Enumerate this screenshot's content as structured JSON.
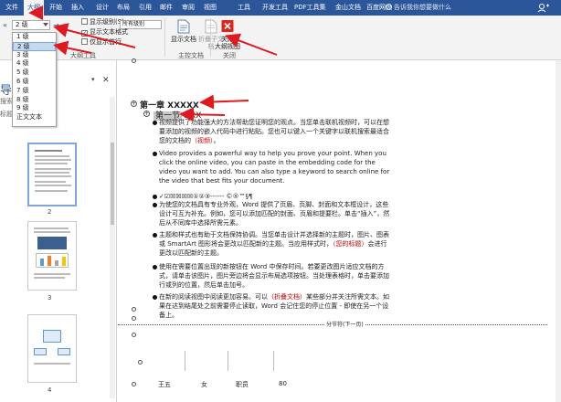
{
  "ribbon_tabs": [
    "文件",
    "大纲",
    "开始",
    "插入",
    "设计",
    "布局",
    "引用",
    "邮件",
    "审阅",
    "视图",
    "工具",
    "开发工具",
    "PDF工具集",
    "金山文档",
    "百度网盘"
  ],
  "active_tab": "大纲",
  "tell_me": "告诉我你想要做什么",
  "outline_tools": {
    "level_value": "2 级",
    "show_level_label": "显示级别(S):",
    "show_level_value": "所有级别",
    "show_text_format": "显示文本格式",
    "show_first_line": "仅显示首行",
    "group_label": "大纲工具"
  },
  "master_doc": {
    "show_document": "显示文档",
    "collapse_subdocs": "折叠子文档",
    "group_label": "主控文档"
  },
  "close_group": {
    "close_label_line1": "关闭",
    "close_label_line2": "大纲视图",
    "group_label": "关闭"
  },
  "level_dropdown": {
    "options": [
      "1 级",
      "2 级",
      "3 级",
      "4 级",
      "5 级",
      "6 级",
      "7 级",
      "8 级",
      "9 级",
      "正文文本"
    ],
    "selected_index": 1
  },
  "nav_pane": {
    "title": "导航",
    "search_placeholder": "搜索文档",
    "tabs_text": "标题",
    "page_numbers": [
      "2",
      "3",
      "4"
    ]
  },
  "document": {
    "heading1": "第一章  XXXXX",
    "heading2_highlight": "第一节",
    "heading2_rest": "XXX",
    "paras": [
      {
        "pre": "视频提供了功能强大的方法帮助您证明您的观点。当您单击联机视频时，可以在想要添加的视频的嵌入代码中进行粘贴。您也可以键入一个关键字以联机搜索最适合您的文档的",
        "red": "（视频）",
        "post": "。"
      },
      {
        "pre": "Video provides a powerful way to help you prove your point. When you click the online video, you can paste in the embedding code for the video you want to add. You can also type a keyword to search online for the video that best fits your document.",
        "red": "",
        "post": ""
      },
      {
        "pre": "✓☑☒☒☒☒①②③------      ©®™§¶",
        "red": "",
        "post": ""
      },
      {
        "pre": "为使您的文档具有专业外观，Word 提供了页眉、页脚、封面和文本框设计，这些设计可互为补充。例如，您可以添加匹配的封面、页眉和提要栏。单击“插入”，然后从不同库中选择所需元素。",
        "red": "",
        "post": ""
      },
      {
        "pre": "主题和样式也有助于文档保持协调。当您单击设计并选择新的主题时，图片、图表或 SmartArt 图形将会更改以匹配新的主题。当应用样式时，",
        "red": "（您的标题）",
        "post": "会进行更改以匹配新的主题。"
      },
      {
        "pre": "使用在需要位置出现的新按钮在 Word 中保存时间。若要更改图片适应文档的方式，请单击该图片，图片旁边将会显示布局选项按钮。当处理表格时，单击要添加行或列的位置，然后单击加号。",
        "red": "",
        "post": ""
      },
      {
        "pre": "在新的阅读视图中阅读更加容易。可以",
        "red": "（折叠文档）",
        "post": "某些部分并关注所需文本。如果在达到结尾处之前需要停止读取，Word 会记住您的停止位置 - 即使在另一个设备上。"
      }
    ],
    "section_break": "分节符(下一页)",
    "table_row": [
      "王五",
      "女",
      "职员",
      "80"
    ]
  },
  "colors": {
    "ribbon_blue": "#2b579a",
    "annotation_red": "#e0191e",
    "highlight_red": "#c00000"
  }
}
